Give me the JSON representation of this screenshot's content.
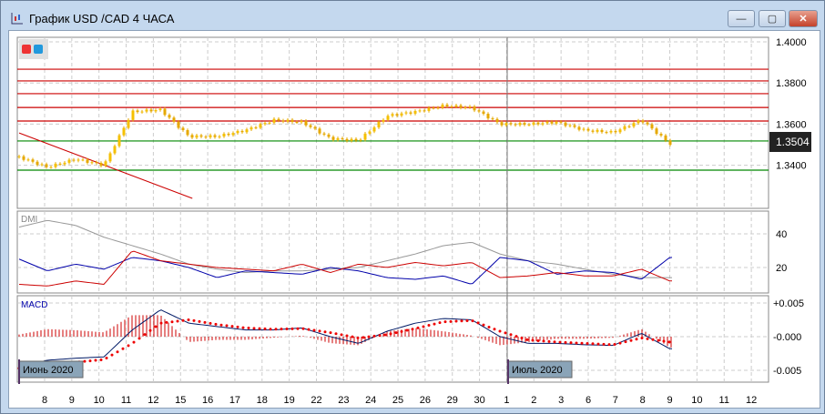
{
  "window": {
    "title": "График USD /CAD  4 ЧАСА",
    "minimize": "—",
    "maximize": "▢",
    "close": "✕"
  },
  "price_axis": {
    "ticks": [
      "1.4000",
      "1.3800",
      "1.3600",
      "1.3400"
    ],
    "current": "1.3504"
  },
  "dmi": {
    "label": "DMI",
    "ticks": [
      "40",
      "20"
    ]
  },
  "macd": {
    "label": "MACD",
    "ticks": [
      "+0.005",
      "-0.000",
      "-0.005"
    ]
  },
  "months": [
    "Июнь 2020",
    "Июль 2020"
  ],
  "chart_data": {
    "type": "candlestick",
    "title": "USD/CAD 4H",
    "x_labels": [
      "8",
      "9",
      "10",
      "11",
      "12",
      "15",
      "16",
      "17",
      "18",
      "19",
      "22",
      "23",
      "24",
      "25",
      "26",
      "29",
      "30",
      "1",
      "2",
      "3",
      "6",
      "7",
      "8",
      "9",
      "10",
      "11",
      "12"
    ],
    "close": [
      1.344,
      1.339,
      1.343,
      1.34,
      1.366,
      1.367,
      1.354,
      1.354,
      1.357,
      1.362,
      1.361,
      1.353,
      1.352,
      1.364,
      1.366,
      1.369,
      1.368,
      1.36,
      1.36,
      1.361,
      1.357,
      1.356,
      1.362,
      1.3504
    ],
    "ylim": [
      1.33,
      1.4
    ],
    "hlines_red": [
      1.3867,
      1.381,
      1.3748,
      1.3681,
      1.3615
    ],
    "hlines_green": [
      1.3518,
      1.3376
    ],
    "trendline": [
      [
        1.3557,
        0
      ],
      [
        1.3239,
        6.1
      ]
    ],
    "dmi": {
      "ylim": [
        0,
        55
      ],
      "adx": [
        44,
        48,
        45,
        38,
        33,
        28,
        22,
        19,
        17,
        18,
        18,
        19,
        20,
        24,
        28,
        33,
        35,
        28,
        24,
        22,
        19,
        16,
        14,
        14
      ],
      "plus_di": [
        25,
        18,
        22,
        19,
        26,
        24,
        20,
        14,
        18,
        17,
        16,
        20,
        18,
        14,
        13,
        15,
        10,
        26,
        24,
        16,
        18,
        17,
        13,
        26
      ],
      "minus_di": [
        10,
        9,
        12,
        10,
        30,
        24,
        22,
        20,
        19,
        18,
        22,
        17,
        22,
        20,
        23,
        21,
        23,
        14,
        15,
        17,
        15,
        15,
        19,
        12
      ]
    },
    "macd": {
      "ylim": [
        -0.0065,
        0.0065
      ],
      "main": [
        -0.0045,
        -0.0035,
        -0.0032,
        -0.003,
        0.001,
        0.004,
        0.002,
        0.0015,
        0.001,
        0.001,
        0.0013,
        0.0,
        -0.001,
        0.0008,
        0.002,
        0.0027,
        0.0025,
        0.0,
        -0.001,
        -0.001,
        -0.0012,
        -0.0013,
        0.0005,
        -0.0018
      ],
      "signal": [
        -0.0047,
        -0.0042,
        -0.0038,
        -0.0034,
        -0.001,
        0.002,
        0.0025,
        0.0018,
        0.0013,
        0.0011,
        0.0012,
        0.0006,
        -0.0002,
        0.0003,
        0.0012,
        0.0022,
        0.0024,
        0.0008,
        -0.0005,
        -0.0008,
        -0.001,
        -0.0012,
        -0.0002,
        -0.0008
      ]
    }
  }
}
